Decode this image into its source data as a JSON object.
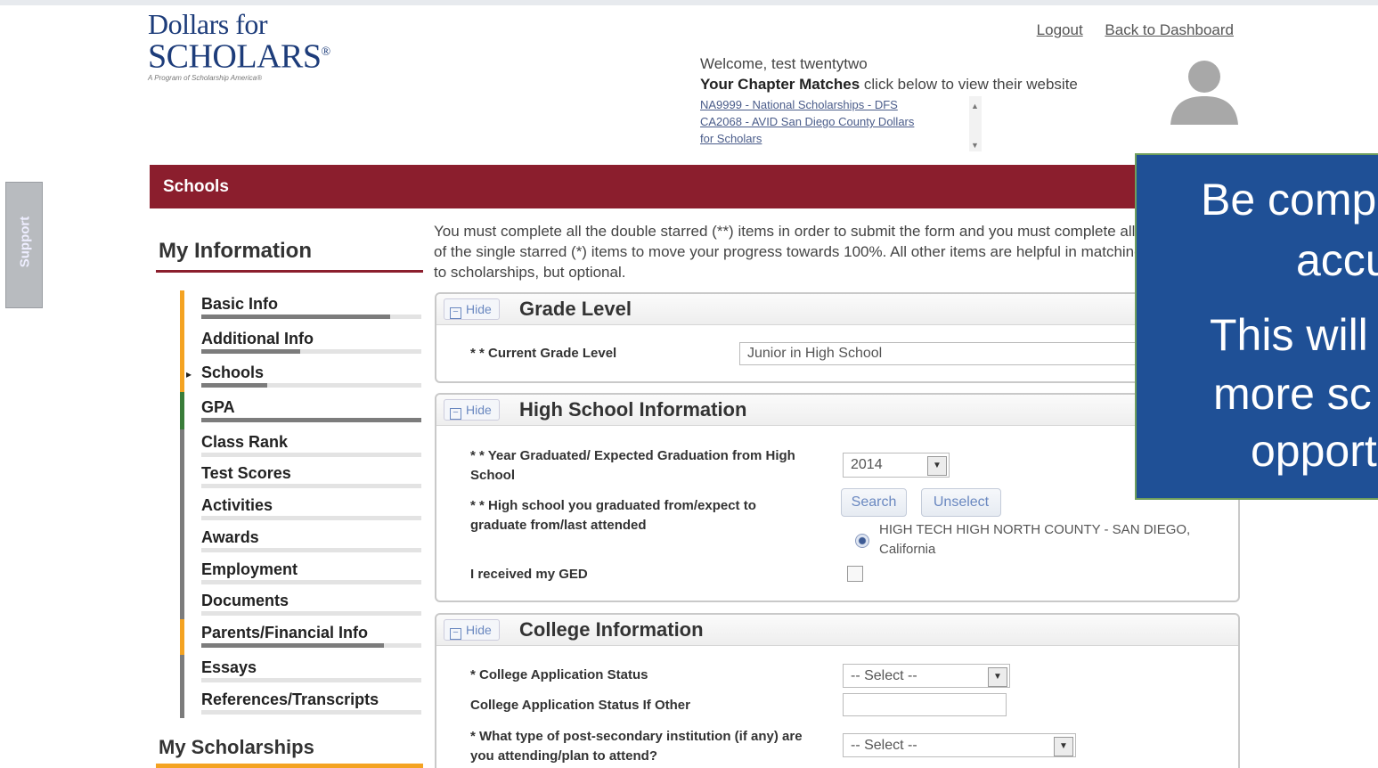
{
  "brand": {
    "line1": "Dollars for",
    "line2": "SCHOLARS",
    "registered": "®",
    "tagline": "A Program of Scholarship America®"
  },
  "header": {
    "logout": "Logout",
    "back_to_dashboard": "Back to Dashboard",
    "welcome": "Welcome, test twentytwo",
    "chapter_matches_bold": "Your Chapter Matches",
    "chapter_matches_rest": " click below to view their website",
    "matches": [
      "NA9999 - National Scholarships - DFS",
      "CA2068 - AVID San Diego County Dollars",
      "for Scholars"
    ]
  },
  "support_tab": "Support",
  "section_bar": "Schools",
  "sidebar": {
    "heading": "My Information",
    "items": [
      {
        "label": "Basic Info",
        "progress": 0.86
      },
      {
        "label": "Additional Info",
        "progress": 0.45
      },
      {
        "label": "Schools",
        "progress": 0.3
      },
      {
        "label": "GPA",
        "progress": 1.0
      },
      {
        "label": "Class Rank",
        "progress": 0
      },
      {
        "label": "Test Scores",
        "progress": 0
      },
      {
        "label": "Activities",
        "progress": 0
      },
      {
        "label": "Awards",
        "progress": 0
      },
      {
        "label": "Employment",
        "progress": 0
      },
      {
        "label": "Documents",
        "progress": 0
      },
      {
        "label": "Parents/Financial Info",
        "progress": 0.83
      },
      {
        "label": "Essays",
        "progress": 0
      },
      {
        "label": "References/Transcripts",
        "progress": 0
      }
    ],
    "second_heading": "My Scholarships",
    "colors": {
      "orange": "#f4a322",
      "green": "#3a7d3a",
      "gray": "#7c7c7c"
    }
  },
  "intro_text": "You must complete all the double starred (**) items in order to submit the form and you must complete all of the single starred (*) items to move your progress towards 100%. All other items are helpful in matching to scholarships, but optional.",
  "panels": {
    "hide_label": "Hide",
    "grade": {
      "title": "Grade Level",
      "current_grade_label": "* * Current Grade Level",
      "current_grade_value": "Junior in High School"
    },
    "high_school": {
      "title": "High School Information",
      "year_label": "* * Year Graduated/ Expected Graduation from High School",
      "year_value": "2014",
      "school_label": "* * High school you graduated from/expect to graduate from/last attended",
      "search": "Search",
      "unselect": "Unselect",
      "selected_school": "HIGH TECH HIGH NORTH COUNTY - SAN DIEGO, California",
      "ged_label": "I received my GED"
    },
    "college": {
      "title": "College Information",
      "status_label": "* College Application Status",
      "status_value": "-- Select --",
      "status_other_label": "College Application Status If Other",
      "institution_label": "* What type of post-secondary institution (if any) are you attending/plan to attend?",
      "institution_value": "-- Select --"
    }
  },
  "callout": {
    "line1": "Be comp",
    "line2": "accu",
    "line3": "This will",
    "line4": "more sc",
    "line5": "opport",
    "bg": "#1f5096"
  }
}
